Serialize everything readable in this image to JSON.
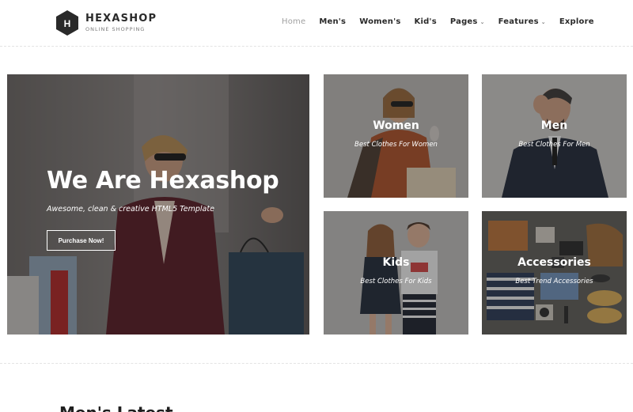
{
  "brand": {
    "logo_letter": "H",
    "name": "HEXASHOP",
    "tagline": "ONLINE SHOPPING"
  },
  "nav": {
    "items": [
      {
        "label": "Home",
        "active": true,
        "dropdown": false
      },
      {
        "label": "Men's",
        "active": false,
        "dropdown": false
      },
      {
        "label": "Women's",
        "active": false,
        "dropdown": false
      },
      {
        "label": "Kid's",
        "active": false,
        "dropdown": false
      },
      {
        "label": "Pages",
        "active": false,
        "dropdown": true
      },
      {
        "label": "Features",
        "active": false,
        "dropdown": true
      },
      {
        "label": "Explore",
        "active": false,
        "dropdown": false
      }
    ],
    "caret_icon": "chevron-down-icon"
  },
  "hero": {
    "title": "We Are Hexashop",
    "subtitle": "Awesome, clean & creative HTML5 Template",
    "button_label": "Purchase Now!"
  },
  "categories": {
    "women": {
      "title": "Women",
      "subtitle": "Best Clothes For Women"
    },
    "men": {
      "title": "Men",
      "subtitle": "Best Clothes For Men"
    },
    "kids": {
      "title": "Kids",
      "subtitle": "Best Clothes For Kids"
    },
    "accessories": {
      "title": "Accessories",
      "subtitle": "Best Trend Accessories"
    }
  },
  "section": {
    "title": "Men's Latest"
  },
  "colors": {
    "text_dark": "#2a2a2a",
    "nav_active": "#a0a0a0",
    "overlay": "#191919"
  }
}
